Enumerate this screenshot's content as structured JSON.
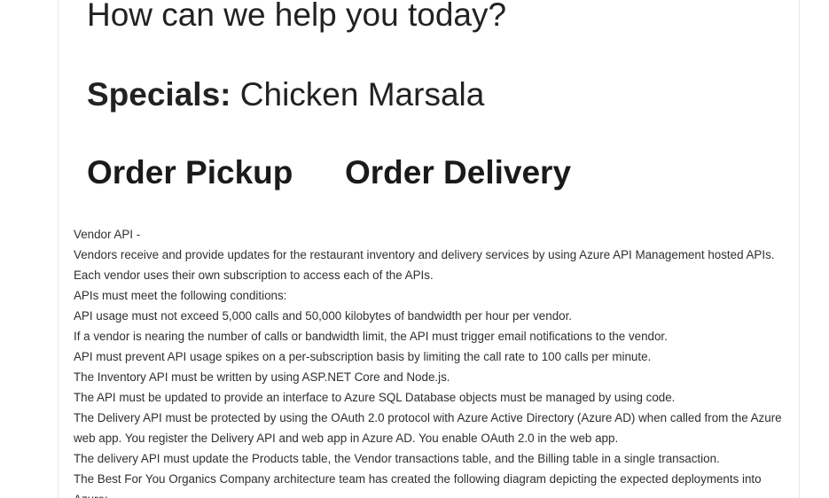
{
  "figure": {
    "heading": "How can we help you today?",
    "specials_label": "Specials:",
    "specials_value": "Chicken Marsala",
    "order_pickup": "Order Pickup",
    "order_delivery": "Order Delivery"
  },
  "paragraphs": [
    "Vendor API -",
    "Vendors receive and provide updates for the restaurant inventory and delivery services by using Azure API Management hosted APIs. Each vendor uses their own subscription to access each of the APIs.",
    "APIs must meet the following conditions:",
    "API usage must not exceed 5,000 calls and 50,000 kilobytes of bandwidth per hour per vendor.",
    "If a vendor is nearing the number of calls or bandwidth limit, the API must trigger email notifications to the vendor.",
    "API must prevent API usage spikes on a per-subscription basis by limiting the call rate to 100 calls per minute.",
    "The Inventory API must be written by using ASP.NET Core and Node.js.",
    "The API must be updated to provide an interface to Azure SQL Database objects must be managed by using code.",
    "The Delivery API must be protected by using the OAuth 2.0 protocol with Azure Active Directory (Azure AD) when called from the Azure web app. You register the Delivery API and web app in Azure AD. You enable OAuth 2.0 in the web app.",
    "The delivery API must update the Products table, the Vendor transactions table, and the Billing table in a single transaction.",
    "The Best For You Organics Company architecture team has created the following diagram depicting the expected deployments into Azure:"
  ]
}
